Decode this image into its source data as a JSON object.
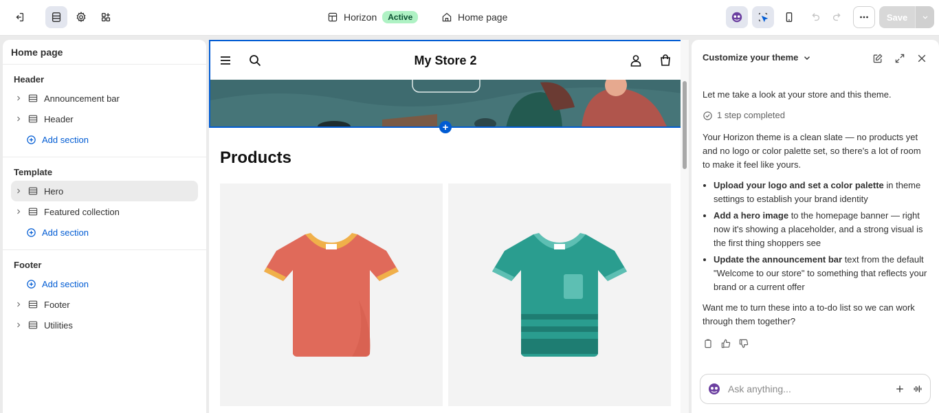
{
  "topbar": {
    "theme_name": "Horizon",
    "theme_status": "Active",
    "page_name": "Home page",
    "save_label": "Save"
  },
  "sidebar": {
    "title": "Home page",
    "groups": [
      {
        "title": "Header",
        "items": [
          "Announcement bar",
          "Header"
        ],
        "add_label": "Add section"
      },
      {
        "title": "Template",
        "items": [
          "Hero",
          "Featured collection"
        ],
        "add_label": "Add section",
        "selected": "Hero"
      },
      {
        "title": "Footer",
        "add_label": "Add section",
        "items": [
          "Footer",
          "Utilities"
        ]
      }
    ]
  },
  "preview": {
    "store_name": "My Store 2",
    "products_heading": "Products",
    "products": [
      {
        "color": "#e06a5a",
        "trim": "#f0b04a"
      },
      {
        "color": "#2a9d8f",
        "trim": "#5dbfb3"
      }
    ]
  },
  "assistant": {
    "title": "Customize your theme",
    "intro": "Let me take a look at your store and this theme.",
    "step": "1 step completed",
    "summary": "Your Horizon theme is a clean slate — no products yet and no logo or color palette set, so there's a lot of room to make it feel like yours.",
    "bullets": [
      {
        "bold": "Upload your logo and set a color palette",
        "rest": " in theme settings to establish your brand identity"
      },
      {
        "bold": "Add a hero image",
        "rest": " to the homepage banner — right now it's showing a placeholder, and a strong visual is the first thing shoppers see"
      },
      {
        "bold": "Update the announcement bar",
        "rest": " text from the default \"Welcome to our store\" to something that reflects your brand or a current offer"
      }
    ],
    "closing": "Want me to turn these into a to-do list so we can work through them together?",
    "input_placeholder": "Ask anything..."
  },
  "colors": {
    "accent": "#005bd3",
    "active_badge_bg": "#aff2c4",
    "active_badge_text": "#0c5132"
  }
}
